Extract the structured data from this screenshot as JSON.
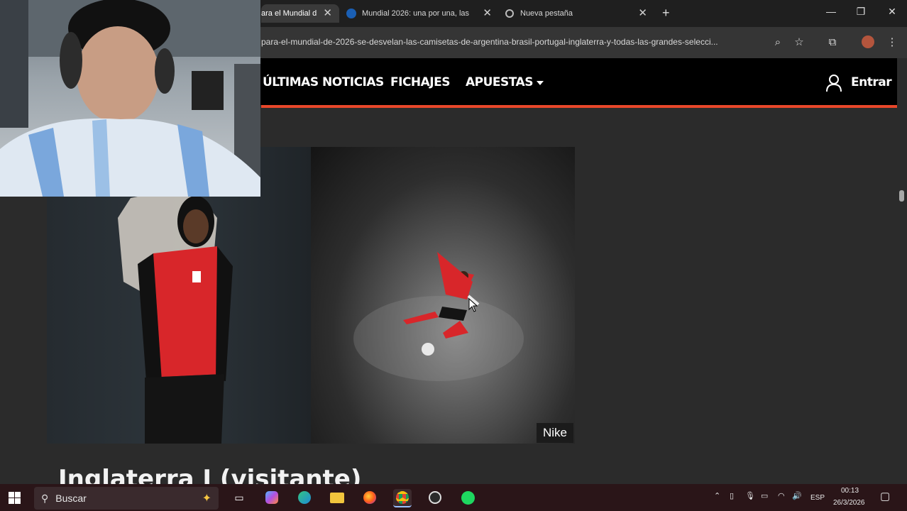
{
  "browser": {
    "tabs": [
      {
        "title": "ara el Mundial d",
        "active": true
      },
      {
        "title": "Mundial 2026: una por una, las",
        "active": false
      },
      {
        "title": "Nueva pestaña",
        "active": false
      }
    ],
    "url": "para-el-mundial-de-2026-se-desvelan-las-camisetas-de-argentina-brasil-portugal-inglaterra-y-todas-las-grandes-selecci...",
    "new_tab": "+",
    "close_glyph": "✕"
  },
  "site": {
    "nav": [
      "ÚLTIMAS NOTICIAS",
      "FICHAJES",
      "APUESTAS"
    ],
    "login_label": "Entrar",
    "accent": "#e8472a"
  },
  "article": {
    "image_caption": "Nike",
    "heading": "Inglaterra I (visitante)"
  },
  "taskbar": {
    "search_label": "Buscar",
    "language": "ESP",
    "time": "00:13",
    "date": "26/3/2026"
  }
}
